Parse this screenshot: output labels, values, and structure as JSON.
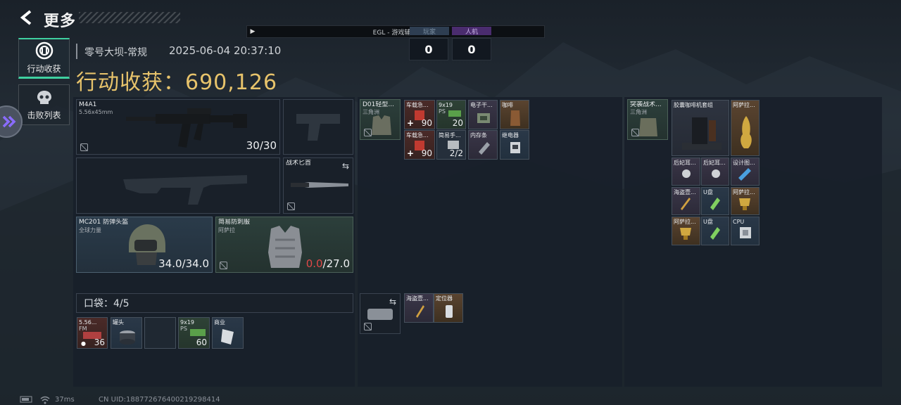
{
  "header": {
    "back_icon": "arrow-left-icon",
    "title": "更多"
  },
  "nav": {
    "items": [
      {
        "label": "行动收获",
        "icon": "loot-emblem-icon",
        "active": true
      },
      {
        "label": "击败列表",
        "icon": "skull-icon",
        "active": false
      }
    ]
  },
  "meta": {
    "map": "零号大坝-常规",
    "datetime": "2025-06-04 20:37:10"
  },
  "loot": {
    "title": "行动收获：690,126"
  },
  "overlay": {
    "title": "EGL - 游戏辅助菜单",
    "team_a_label": "人机",
    "team_a_hidden_label": "玩家",
    "score_a": "0",
    "score_b": "0"
  },
  "gear": {
    "primary": {
      "name": "M4A1",
      "caliber": "5.56x45mm",
      "ammo": "30/30"
    },
    "melee": {
      "name": "战术匕首"
    },
    "helmet": {
      "name": "MC201 防弹头盔",
      "brand": "全球力量",
      "durability": "34.0/34.0"
    },
    "armor": {
      "name": "简易防刺服",
      "brand": "阿萨拉",
      "durability_cur": "0.0",
      "durability_max": "/27.0"
    }
  },
  "pockets": {
    "label": "口袋：4/5",
    "items": [
      {
        "name": "5.56...",
        "sub": "FM",
        "count": "36"
      },
      {
        "name": "罐头",
        "sub": "",
        "count": ""
      },
      {
        "name": "",
        "sub": "",
        "count": ""
      },
      {
        "name": "9x19",
        "sub": "PS",
        "count": "60"
      },
      {
        "name": "商业",
        "sub": "",
        "count": ""
      }
    ]
  },
  "chest": {
    "name": "D01轻型...",
    "brand": "三角洲",
    "items": [
      {
        "name": "车载急...",
        "count": "90"
      },
      {
        "name": "9x19",
        "sub": "PS",
        "count": "20"
      },
      {
        "name": "电子干..."
      },
      {
        "name": "咖啡"
      },
      {
        "name": "车载急...",
        "count": "90"
      },
      {
        "name": "简易手...",
        "count": "2/2"
      },
      {
        "name": "内存条"
      },
      {
        "name": "继电器"
      }
    ]
  },
  "case": {
    "items": [
      {
        "name": "海盗壹..."
      },
      {
        "name": "定位器"
      }
    ]
  },
  "backpack": {
    "name": "突袭战术...",
    "brand": "三角洲",
    "items": [
      {
        "name": "胶囊咖啡机套组"
      },
      {
        "name": "阿萨拉..."
      },
      {
        "name": "后妃耳..."
      },
      {
        "name": "后妃耳..."
      },
      {
        "name": "设计图..."
      },
      {
        "name": "海盗壹..."
      },
      {
        "name": "U盘"
      },
      {
        "name": "阿萨拉..."
      },
      {
        "name": "阿萨拉..."
      },
      {
        "name": "U盘"
      },
      {
        "name": "CPU"
      }
    ]
  },
  "footer": {
    "ping": "37ms",
    "uid": "CN UID:188772676400219298414"
  },
  "colors": {
    "accent": "#3fd0a0",
    "gold": "#e7c36b",
    "red": "#e04848",
    "purple": "#6a3a9a"
  }
}
